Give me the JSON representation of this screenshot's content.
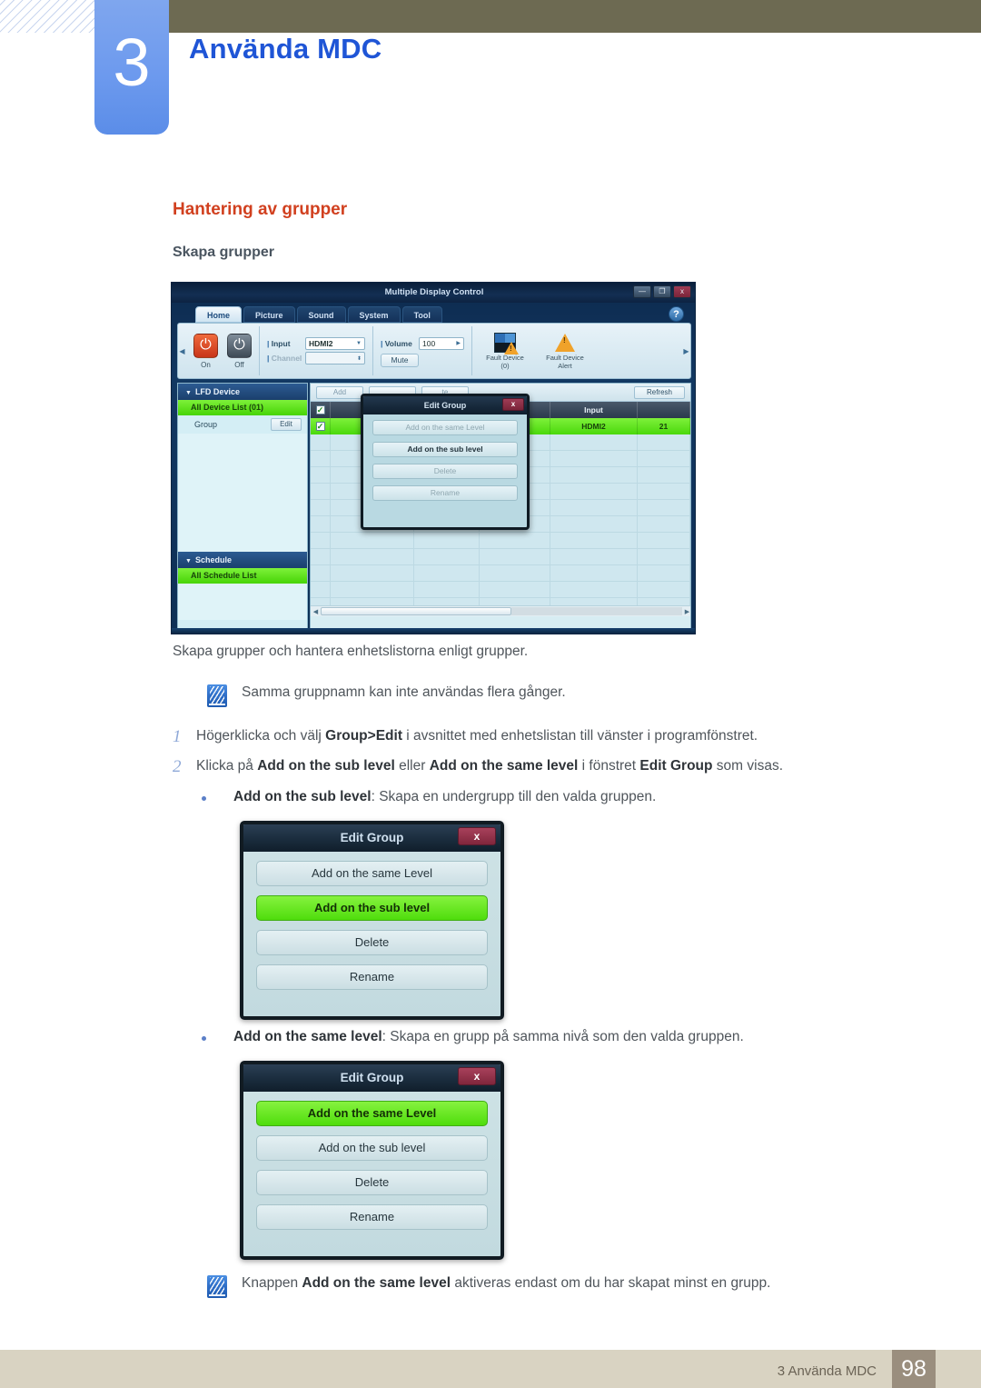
{
  "header": {
    "chapter_number": "3",
    "chapter_title": "Använda MDC"
  },
  "section": {
    "title": "Hantering av grupper",
    "subtitle": "Skapa grupper"
  },
  "mdc_window": {
    "title": "Multiple Display Control",
    "window_buttons": {
      "minimize": "—",
      "maximize": "❐",
      "close": "x"
    },
    "help_label": "?",
    "tabs": [
      {
        "label": "Home",
        "active": true
      },
      {
        "label": "Picture",
        "active": false
      },
      {
        "label": "Sound",
        "active": false
      },
      {
        "label": "System",
        "active": false
      },
      {
        "label": "Tool",
        "active": false
      }
    ],
    "toolbar": {
      "power_on": "On",
      "power_off": "Off",
      "input_label": "Input",
      "input_value": "HDMI2",
      "channel_label": "Channel",
      "channel_value": "",
      "volume_label": "Volume",
      "volume_value": "100",
      "mute_label": "Mute",
      "fault_device_label": "Fault Device",
      "fault_device_count": "(0)",
      "fault_alert_label_1": "Fault Device",
      "fault_alert_label_2": "Alert"
    },
    "left_panel": {
      "lfd_header": "LFD Device",
      "all_device_list": "All Device List (01)",
      "group_label": "Group",
      "edit_button": "Edit",
      "schedule_header": "Schedule",
      "all_schedule_list": "All Schedule List"
    },
    "table": {
      "buttons": {
        "add": "Add",
        "delete": "te",
        "refresh": "Refresh"
      },
      "columns": [
        "",
        "",
        "",
        "wer",
        "Input",
        ""
      ],
      "row": {
        "power": "",
        "input": "HDMI2",
        "last": "21"
      }
    },
    "inner_dialog": {
      "title": "Edit Group",
      "close": "x",
      "buttons": [
        {
          "label": "Add on the same Level",
          "enabled": false
        },
        {
          "label": "Add on the sub level",
          "enabled": true
        },
        {
          "label": "Delete",
          "enabled": false
        },
        {
          "label": "Rename",
          "enabled": false
        }
      ]
    }
  },
  "body": {
    "intro": "Skapa grupper och hantera enhetslistorna enligt grupper.",
    "note1": "Samma gruppnamn kan inte användas flera gånger.",
    "step1": {
      "number": "1",
      "pre": "Högerklicka och välj ",
      "bold": "Group>Edit",
      "post": " i avsnittet med enhetslistan till vänster i programfönstret."
    },
    "step2": {
      "number": "2",
      "pre": "Klicka på ",
      "bold1": "Add on the sub level",
      "mid1": " eller ",
      "bold2": "Add on the same level",
      "mid2": " i fönstret ",
      "bold3": "Edit Group",
      "post": " som visas."
    },
    "bullet1": {
      "bold": "Add on the sub level",
      "rest": ": Skapa en undergrupp till den valda gruppen."
    },
    "bullet2": {
      "bold": "Add on the same level",
      "rest": ": Skapa en grupp på samma nivå som den valda gruppen."
    },
    "note2": {
      "pre": "Knappen ",
      "bold": "Add on the same level",
      "post": " aktiveras endast om du har skapat minst en grupp."
    }
  },
  "dialog_sub": {
    "title": "Edit Group",
    "close": "x",
    "buttons": [
      {
        "label": "Add on the same Level",
        "highlighted": false
      },
      {
        "label": "Add on the sub level",
        "highlighted": true
      },
      {
        "label": "Delete",
        "highlighted": false
      },
      {
        "label": "Rename",
        "highlighted": false
      }
    ]
  },
  "dialog_same": {
    "title": "Edit Group",
    "close": "x",
    "buttons": [
      {
        "label": "Add on the same Level",
        "highlighted": true
      },
      {
        "label": "Add on the sub level",
        "highlighted": false
      },
      {
        "label": "Delete",
        "highlighted": false
      },
      {
        "label": "Rename",
        "highlighted": false
      }
    ]
  },
  "footer": {
    "text": "3 Använda MDC",
    "page": "98"
  }
}
